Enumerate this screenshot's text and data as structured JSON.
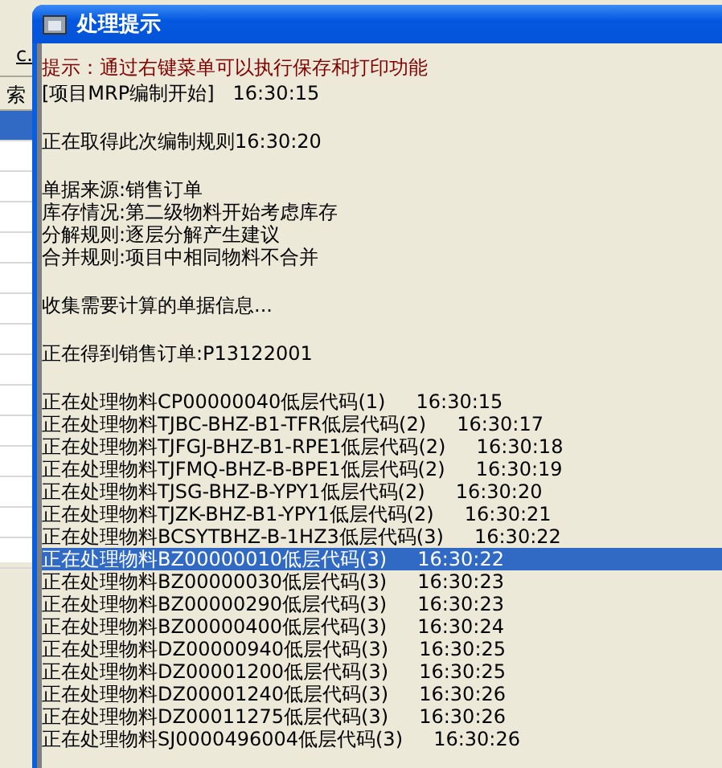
{
  "background_window": {
    "label": "c.",
    "column_header": "索",
    "rows": [
      {
        "selected": true
      },
      {
        "selected": false
      },
      {
        "selected": false
      },
      {
        "selected": false
      },
      {
        "selected": false
      },
      {
        "selected": false
      },
      {
        "selected": false
      },
      {
        "selected": false
      },
      {
        "selected": false
      },
      {
        "selected": false
      },
      {
        "selected": false
      },
      {
        "selected": false
      },
      {
        "selected": false
      },
      {
        "selected": false
      },
      {
        "selected": false
      }
    ]
  },
  "window": {
    "title": "处理提示"
  },
  "hint": "提示：通过右键菜单可以执行保存和打印功能",
  "log_groups": [
    [
      {
        "text": "[项目MRP编制开始]   16:30:15",
        "selected": false
      }
    ],
    [
      {
        "text": "正在取得此次编制规则16:30:20",
        "selected": false
      }
    ],
    [
      {
        "text": "单据来源:销售订单",
        "selected": false
      },
      {
        "text": "库存情况:第二级物料开始考虑库存",
        "selected": false
      },
      {
        "text": "分解规则:逐层分解产生建议",
        "selected": false
      },
      {
        "text": "合并规则:项目中相同物料不合并",
        "selected": false
      }
    ],
    [
      {
        "text": "收集需要计算的单据信息...",
        "selected": false
      }
    ],
    [
      {
        "text": "正在得到销售订单:P13122001",
        "selected": false
      }
    ],
    [
      {
        "text": "正在处理物料CP00000040低层代码(1)     16:30:15",
        "selected": false
      },
      {
        "text": "正在处理物料TJBC-BHZ-B1-TFR低层代码(2)     16:30:17",
        "selected": false
      },
      {
        "text": "正在处理物料TJFGJ-BHZ-B1-RPE1低层代码(2)     16:30:18",
        "selected": false
      },
      {
        "text": "正在处理物料TJFMQ-BHZ-B-BPE1低层代码(2)     16:30:19",
        "selected": false
      },
      {
        "text": "正在处理物料TJSG-BHZ-B-YPY1低层代码(2)     16:30:20",
        "selected": false
      },
      {
        "text": "正在处理物料TJZK-BHZ-B1-YPY1低层代码(2)     16:30:21",
        "selected": false
      },
      {
        "text": "正在处理物料BCSYTBHZ-B-1HZ3低层代码(3)     16:30:22",
        "selected": false
      },
      {
        "text": "正在处理物料BZ00000010低层代码(3)     16:30:22",
        "selected": true
      },
      {
        "text": "正在处理物料BZ00000030低层代码(3)     16:30:23",
        "selected": false
      },
      {
        "text": "正在处理物料BZ00000290低层代码(3)     16:30:23",
        "selected": false
      },
      {
        "text": "正在处理物料BZ00000400低层代码(3)     16:30:24",
        "selected": false
      },
      {
        "text": "正在处理物料DZ00000940低层代码(3)     16:30:25",
        "selected": false
      },
      {
        "text": "正在处理物料DZ00001200低层代码(3)     16:30:25",
        "selected": false
      },
      {
        "text": "正在处理物料DZ00001240低层代码(3)     16:30:26",
        "selected": false
      },
      {
        "text": "正在处理物料DZ00011275低层代码(3)     16:30:26",
        "selected": false
      },
      {
        "text": "正在处理物料SJ0000496004低层代码(3)     16:30:26",
        "selected": false
      }
    ]
  ]
}
